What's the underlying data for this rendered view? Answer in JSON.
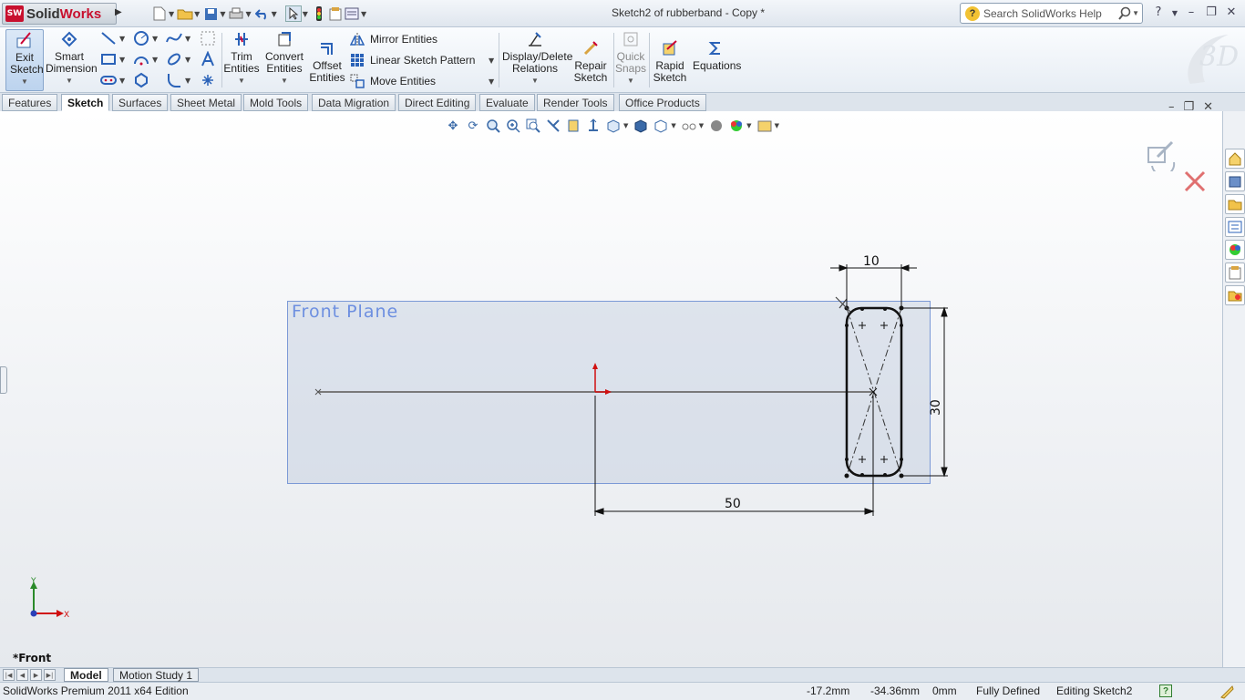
{
  "app": {
    "name_prefix": "Solid",
    "name_suffix": "Works"
  },
  "window": {
    "title": "Sketch2 of rubberband - Copy *"
  },
  "search": {
    "placeholder": "Search SolidWorks Help"
  },
  "quick_access": [
    "new-icon",
    "open-icon",
    "save-icon",
    "print-icon",
    "undo-icon",
    "select-icon",
    "rebuild-icon",
    "file-properties-icon",
    "options-icon"
  ],
  "ribbon": {
    "exit_sketch": "Exit Sketch",
    "smart_dimension": "Smart Dimension",
    "trim_entities": "Trim Entities",
    "convert_entities": "Convert Entities",
    "offset_entities": "Offset Entities",
    "mirror_entities": "Mirror Entities",
    "linear_sketch_pattern": "Linear Sketch Pattern",
    "move_entities": "Move Entities",
    "display_delete_relations": "Display/Delete Relations",
    "repair_sketch": "Repair Sketch",
    "quick_snaps": "Quick Snaps",
    "rapid_sketch": "Rapid Sketch",
    "equations": "Equations"
  },
  "tabs": [
    "Features",
    "Sketch",
    "Surfaces",
    "Sheet Metal",
    "Mold Tools",
    "Data Migration",
    "Direct Editing",
    "Evaluate",
    "Render Tools",
    "Office Products"
  ],
  "active_tab": "Sketch",
  "graphics": {
    "plane_label": "Front Plane",
    "dim_width": "10",
    "dim_height": "30",
    "dim_distance": "50",
    "view_name": "*Front",
    "triad_y": "Y",
    "triad_x": "X"
  },
  "bottom_tabs": [
    "Model",
    "Motion Study 1"
  ],
  "status": {
    "edition": "SolidWorks Premium 2011 x64 Edition",
    "x": "-17.2mm",
    "y": "-34.36mm",
    "z": "0mm",
    "state": "Fully Defined",
    "editing": "Editing Sketch2"
  },
  "colors": {
    "accent": "#3a6aa8",
    "plane_label": "#6d8fe0",
    "origin_red": "#d01010"
  }
}
